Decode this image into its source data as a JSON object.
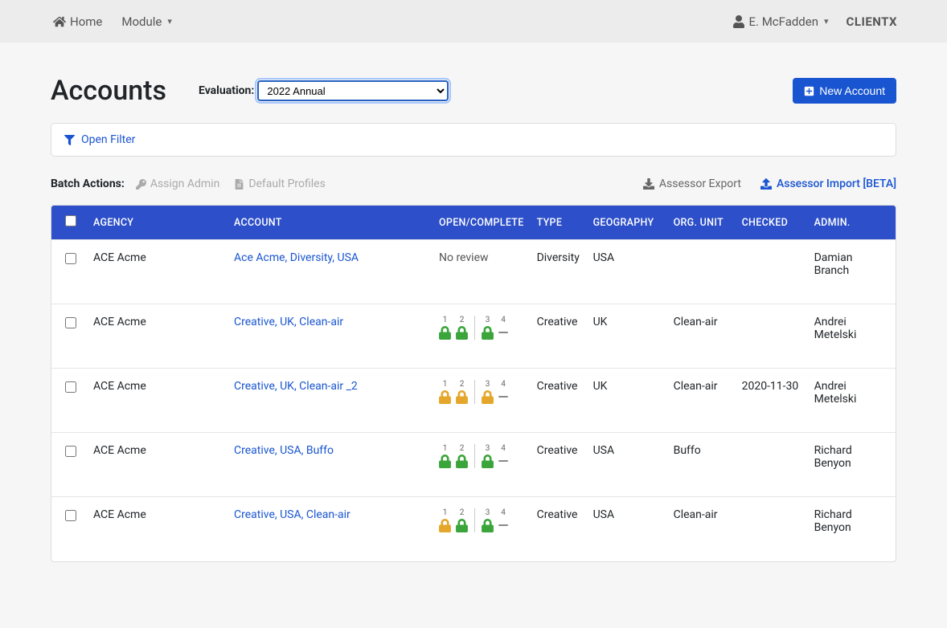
{
  "nav": {
    "home": "Home",
    "module": "Module",
    "user": "E. McFadden",
    "brand": "CLIENTX"
  },
  "header": {
    "title": "Accounts",
    "eval_label": "Evaluation:",
    "eval_value": "2022 Annual",
    "new_button": "New Account"
  },
  "filter": {
    "open": "Open Filter"
  },
  "batch": {
    "label": "Batch Actions:",
    "assign_admin": "Assign Admin",
    "default_profiles": "Default Profiles",
    "assessor_export": "Assessor Export",
    "assessor_import": "Assessor Import [BETA]"
  },
  "columns": {
    "agency": "AGENCY",
    "account": "ACCOUNT",
    "oc": "OPEN/COMPLETE",
    "type": "TYPE",
    "geo": "GEOGRAPHY",
    "org": "ORG. UNIT",
    "checked": "CHECKED",
    "admin": "ADMIN."
  },
  "rows": [
    {
      "agency": "ACE Acme",
      "account": "Ace Acme, Diversity, USA",
      "oc_text": "No review",
      "locks": null,
      "type": "Diversity",
      "geo": "USA",
      "org": "",
      "checked": "",
      "admin": "Damian Branch"
    },
    {
      "agency": "ACE Acme",
      "account": "Creative, UK, Clean-air",
      "oc_text": "",
      "locks": [
        [
          "green",
          "green"
        ],
        [
          "green",
          "dash"
        ]
      ],
      "type": "Creative",
      "geo": "UK",
      "org": "Clean-air",
      "checked": "",
      "admin": "Andrei Metelski"
    },
    {
      "agency": "ACE Acme",
      "account": "Creative, UK, Clean-air _2",
      "oc_text": "",
      "locks": [
        [
          "orange",
          "orange"
        ],
        [
          "orange",
          "dash"
        ]
      ],
      "type": "Creative",
      "geo": "UK",
      "org": "Clean-air",
      "checked": "2020-11-30",
      "admin": "Andrei Metelski"
    },
    {
      "agency": "ACE Acme",
      "account": "Creative, USA, Buffo",
      "oc_text": "",
      "locks": [
        [
          "green",
          "green"
        ],
        [
          "green",
          "dash"
        ]
      ],
      "type": "Creative",
      "geo": "USA",
      "org": "Buffo",
      "checked": "",
      "admin": "Richard Benyon"
    },
    {
      "agency": "ACE Acme",
      "account": "Creative, USA, Clean-air",
      "oc_text": "",
      "locks": [
        [
          "orange",
          "green"
        ],
        [
          "green",
          "dash"
        ]
      ],
      "type": "Creative",
      "geo": "USA",
      "org": "Clean-air",
      "checked": "",
      "admin": "Richard Benyon"
    }
  ]
}
